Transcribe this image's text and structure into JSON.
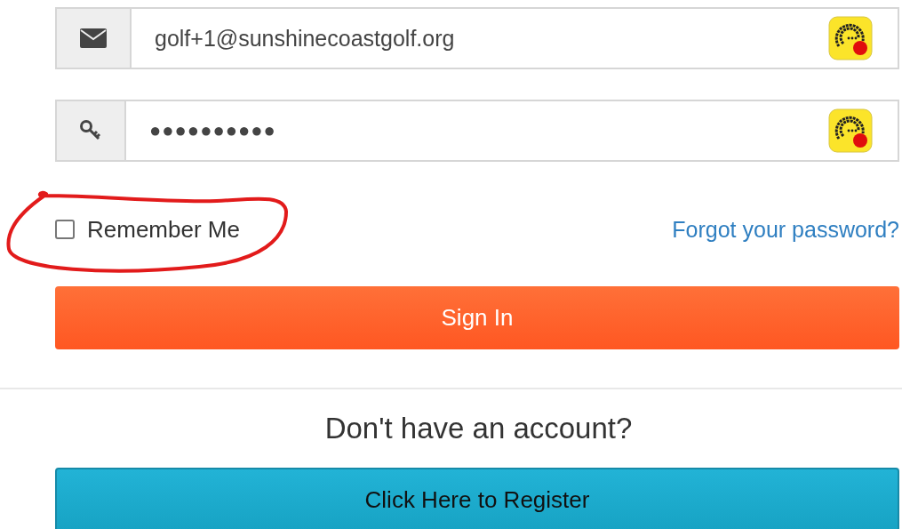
{
  "email_field": {
    "value": "golf+1@sunshinecoastgolf.org"
  },
  "password_field": {
    "value": "●●●●●●●●●●"
  },
  "remember_me": {
    "label": "Remember Me",
    "checked": false
  },
  "forgot_link": "Forgot your password?",
  "sign_in_button": "Sign In",
  "register_prompt": "Don't have an account?",
  "register_button": "Click Here to Register"
}
